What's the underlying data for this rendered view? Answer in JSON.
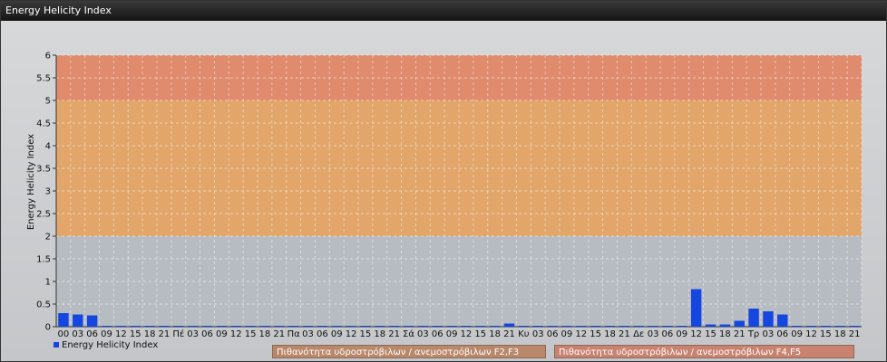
{
  "window": {
    "title": "Energy Helicity Index"
  },
  "chart_data": {
    "type": "bar",
    "title": "",
    "ylabel": "Energy Helicity Index",
    "ylim": [
      0,
      6
    ],
    "yticks": [
      "0",
      "0.5",
      "1",
      "1.5",
      "2",
      "2.5",
      "3",
      "3.5",
      "4",
      "4.5",
      "5",
      "5.5",
      "6"
    ],
    "categories": [
      "00",
      "03",
      "06",
      "09",
      "12",
      "15",
      "18",
      "21",
      "Πέ",
      "03",
      "06",
      "09",
      "12",
      "15",
      "18",
      "21",
      "Πα",
      "03",
      "06",
      "09",
      "12",
      "15",
      "18",
      "21",
      "Σά",
      "03",
      "06",
      "09",
      "12",
      "15",
      "18",
      "21",
      "Κυ",
      "03",
      "06",
      "09",
      "12",
      "15",
      "18",
      "21",
      "Δε",
      "03",
      "06",
      "09",
      "12",
      "15",
      "18",
      "21",
      "Τρ",
      "03",
      "06",
      "09",
      "12",
      "15",
      "18",
      "21"
    ],
    "series": [
      {
        "name": "Energy Helicity Index",
        "color": "#1446e0",
        "values": [
          0.3,
          0.27,
          0.25,
          0.02,
          0.02,
          0.02,
          0.02,
          0.02,
          0.02,
          0.02,
          0.02,
          0.02,
          0.02,
          0.02,
          0.02,
          0.02,
          0.02,
          0.02,
          0.02,
          0.02,
          0.02,
          0.02,
          0.02,
          0.02,
          0.02,
          0.02,
          0.02,
          0.02,
          0.02,
          0.02,
          0.02,
          0.07,
          0.02,
          0.02,
          0.02,
          0.02,
          0.02,
          0.02,
          0.02,
          0.02,
          0.02,
          0.02,
          0.02,
          0.02,
          0.83,
          0.05,
          0.05,
          0.13,
          0.4,
          0.34,
          0.27,
          0.02,
          0.02,
          0.02,
          0.02,
          0.02
        ]
      }
    ],
    "bands": [
      {
        "from": 0,
        "to": 2,
        "color": "#b7bcc2"
      },
      {
        "from": 2,
        "to": 5,
        "color": "#e2a56a"
      },
      {
        "from": 5,
        "to": 6,
        "color": "#e08a6e"
      }
    ],
    "grid": true,
    "legend_position": "bottom-left"
  },
  "band_labels": [
    {
      "text": "Πιθανότητα υδροστρόβιλων / ανεμοστρόβιλων F2,F3",
      "color": "#b9876a"
    },
    {
      "text": "Πιθανότητα υδροστρόβιλων / ανεμοστρόβιλων F4,F5",
      "color": "#c98270"
    }
  ]
}
